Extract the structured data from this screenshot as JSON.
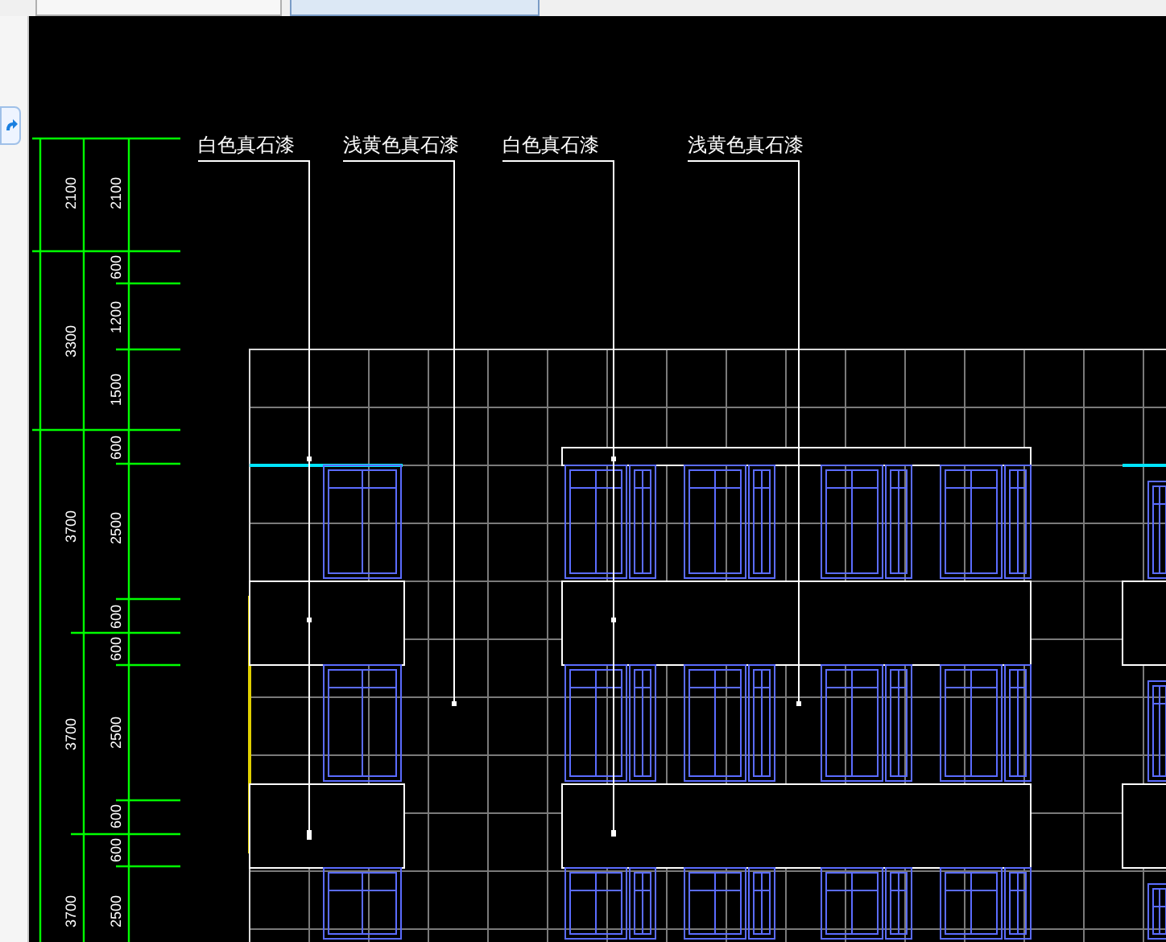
{
  "tabs": [
    {
      "selected": false
    },
    {
      "selected": true
    }
  ],
  "material_labels": [
    {
      "text": "白色真石漆"
    },
    {
      "text": "浅黄色真石漆"
    },
    {
      "text": "白色真石漆"
    },
    {
      "text": "浅黄色真石漆"
    }
  ],
  "dimensions": {
    "column_1": [
      "2100",
      "3300",
      "3700",
      "3700",
      "3700"
    ],
    "column_2": [
      "2100",
      "600",
      "1200",
      "1500",
      "600",
      "2500",
      "600",
      "600",
      "2500",
      "600",
      "600",
      "2500"
    ]
  }
}
